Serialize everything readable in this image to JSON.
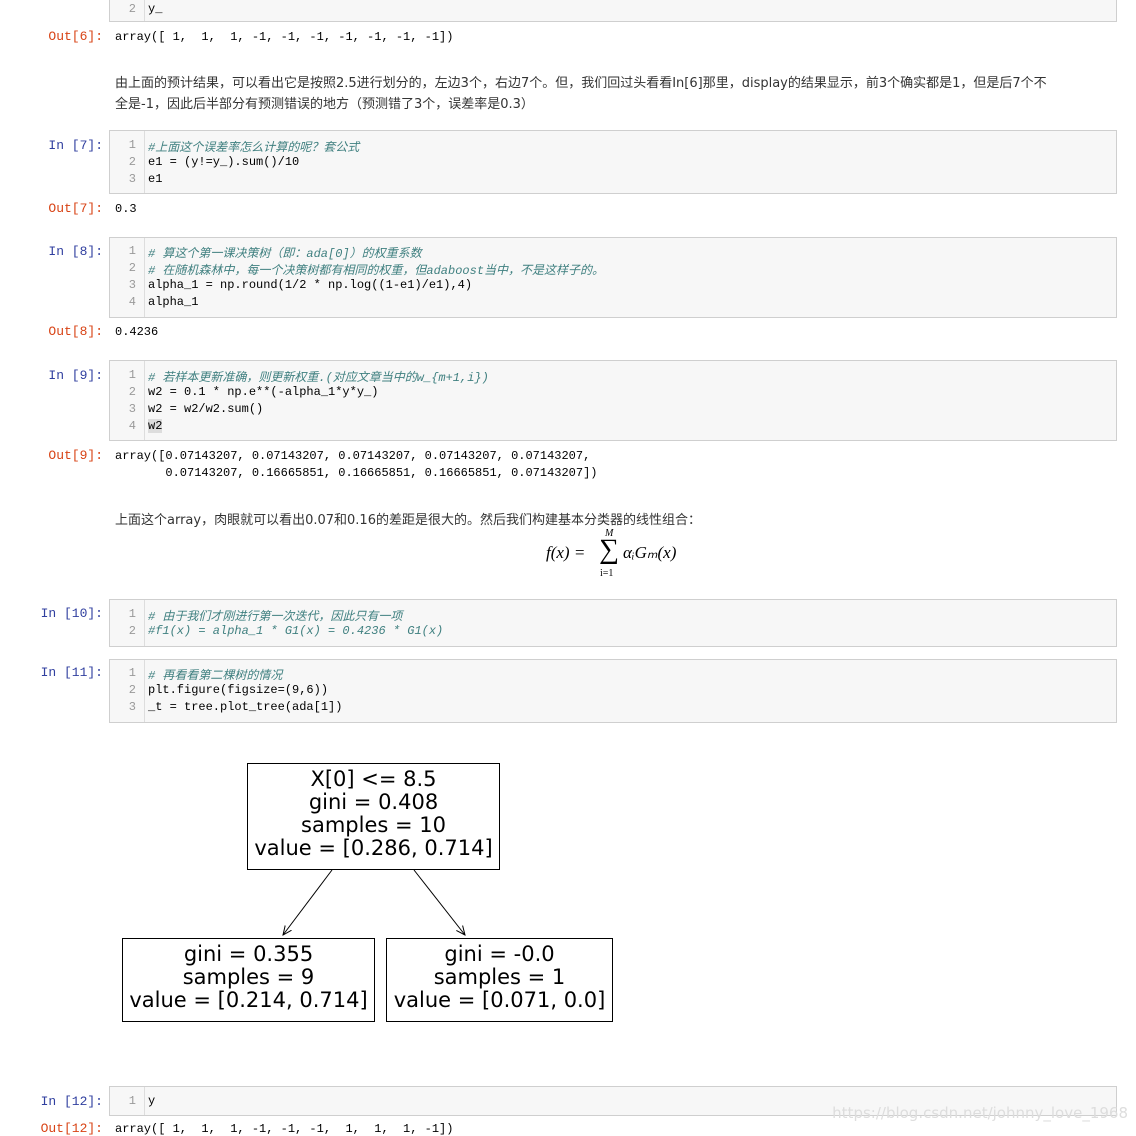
{
  "cells": {
    "c6": {
      "lines": [
        "y_"
      ],
      "line_start": 2,
      "out_label": "Out[6]:",
      "output": "array([ 1,  1,  1, -1, -1, -1, -1, -1, -1, -1])"
    },
    "md1": {
      "line1": "由上面的预计结果，可以看出它是按照2.5进行划分的，左边3个，右边7个。但，我们回过头看看In[6]那里，display的结果显示，前3个确实都是1，但是后7个不",
      "line2": "全是-1，因此后半部分有预测错误的地方（预测错了3个，误差率是0.3）"
    },
    "c7": {
      "in_label": "In  [7]:",
      "lines": [
        "#上面这个误差率怎么计算的呢？套公式",
        "e1 = (y!=y_).sum()/10",
        "e1"
      ],
      "out_label": "Out[7]:",
      "output": "0.3"
    },
    "c8": {
      "in_label": "In  [8]:",
      "lines": [
        "# 算这个第一课决策树（即：ada[0]）的权重系数",
        "# 在随机森林中，每一个决策树都有相同的权重，但adaboost当中，不是这样子的。",
        "alpha_1 = np.round(1/2 * np.log((1-e1)/e1),4)",
        "alpha_1"
      ],
      "out_label": "Out[8]:",
      "output": "0.4236"
    },
    "c9": {
      "in_label": "In  [9]:",
      "lines": [
        "# 若样本更新准确，则更新权重.(对应文章当中的w_{m+1,i})",
        "w2 = 0.1 * np.e**(-alpha_1*y*y_)",
        "w2 = w2/w2.sum()",
        "w2"
      ],
      "out_label": "Out[9]:",
      "output_line1": "array([0.07143207, 0.07143207, 0.07143207, 0.07143207, 0.07143207,",
      "output_line2": "       0.07143207, 0.16665851, 0.16665851, 0.16665851, 0.07143207])"
    },
    "md2": {
      "text": "上面这个array，肉眼就可以看出0.07和0.16的差距是很大的。然后我们构建基本分类器的线性组合：",
      "formula_lhs": "f(x) =",
      "formula_sum": "∑",
      "formula_upper": "M",
      "formula_lower": "i=1",
      "formula_rhs": "αᵢGₘ(x)"
    },
    "c10": {
      "in_label": "In  [10]:",
      "lines": [
        "# 由于我们才刚进行第一次迭代，因此只有一项",
        "#f1(x) = alpha_1 * G1(x) = 0.4236 * G1(x)"
      ]
    },
    "c11": {
      "in_label": "In  [11]:",
      "lines": [
        "# 再看看第二棵树的情况",
        "plt.figure(figsize=(9,6))",
        "_t = tree.plot_tree(ada[1])"
      ]
    },
    "c12": {
      "in_label": "In  [12]:",
      "lines": [
        "y"
      ],
      "out_label": "Out[12]:",
      "output": "array([ 1,  1,  1, -1, -1, -1,  1,  1,  1, -1])"
    }
  },
  "tree": {
    "root": [
      "X[0] <= 8.5",
      "gini = 0.408",
      "samples = 10",
      "value = [0.286, 0.714]"
    ],
    "left": [
      "gini = 0.355",
      "samples = 9",
      "value = [0.214, 0.714]"
    ],
    "right": [
      "gini = -0.0",
      "samples = 1",
      "value = [0.071, 0.0]"
    ]
  },
  "watermark": "https://blog.csdn.net/johnny_love_1968"
}
